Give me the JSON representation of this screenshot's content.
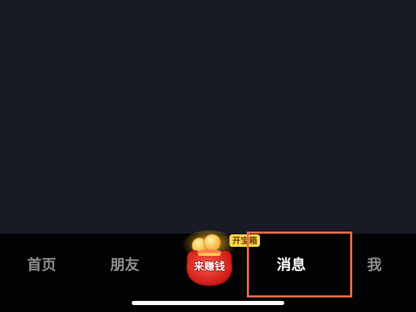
{
  "nav": {
    "home_label": "首页",
    "friends_label": "朋友",
    "messages_label": "消息",
    "me_label": "我",
    "active": "messages"
  },
  "earn": {
    "label": "来赚钱",
    "badge": "开宝箱",
    "icon": "red-money-bag-icon"
  },
  "colors": {
    "content_bg": "#181a26",
    "nav_bg": "#030304",
    "inactive_text": "#8e8e93",
    "active_text": "#ffffff",
    "highlight": "#ee6c4d"
  }
}
